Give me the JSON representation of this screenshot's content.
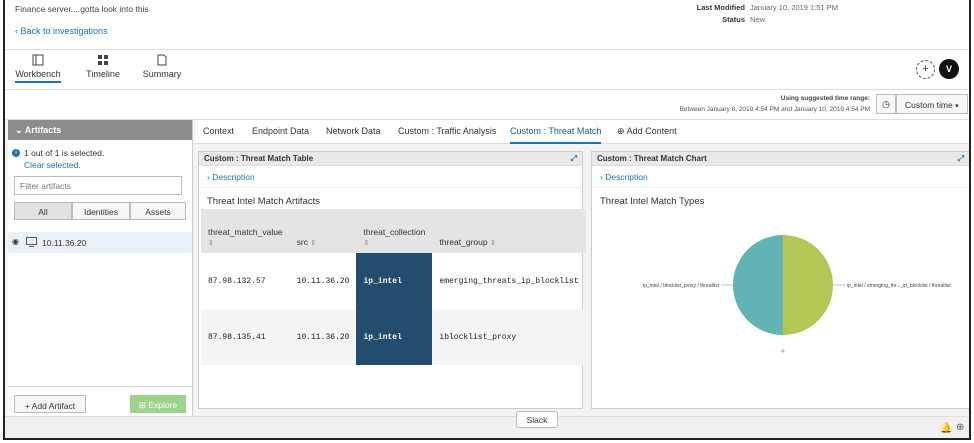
{
  "header": {
    "title": "Finance server....gotta look into this",
    "back_link": "Back to investigations",
    "last_modified_label": "Last Modified",
    "last_modified_value": "January 10, 2019 1:51 PM",
    "status_label": "Status",
    "status_value": "New"
  },
  "nav": {
    "tabs": [
      {
        "label": "Workbench",
        "icon": "workbench-icon"
      },
      {
        "label": "Timeline",
        "icon": "timeline-icon"
      },
      {
        "label": "Summary",
        "icon": "summary-icon"
      }
    ],
    "add_button": "+",
    "avatar": "V"
  },
  "time": {
    "label": "Using suggested time range:",
    "range": "Between January 8, 2019 4:54 PM and January 10, 2019 4:54 PM",
    "button": "Custom time"
  },
  "sidebar": {
    "heading": "Artifacts",
    "selection_text": "1 out of 1 is selected.",
    "clear_link": "Clear selected.",
    "filter_placeholder": "Filter artifacts",
    "segments": [
      "All",
      "Identities",
      "Assets"
    ],
    "artifact": "10.11.36.20",
    "add_button": "+ Add Artifact",
    "explore_button": "Explore"
  },
  "content_tabs": [
    "Context",
    "Endpoint Data",
    "Network Data",
    "Custom : Traffic Analysis",
    "Custom : Threat Match",
    "Add Content"
  ],
  "table_panel": {
    "title": "Custom : Threat Match Table",
    "description": "Description",
    "subtitle": "Threat Intel Match Artifacts",
    "columns": [
      "threat_match_value",
      "src",
      "threat_collection",
      "threat_group"
    ],
    "rows": [
      [
        "87.98.132.57",
        "10.11.36.20",
        "ip_intel",
        "emerging_threats_ip_blocklist"
      ],
      [
        "87.98.135.41",
        "10.11.36.20",
        "ip_intel",
        "iblocklist_proxy"
      ]
    ]
  },
  "chart_panel": {
    "title": "Custom : Threat Match Chart",
    "description": "Description",
    "subtitle": "Threat Intel Match Types"
  },
  "chart_data": {
    "type": "pie",
    "title": "Threat Intel Match Types",
    "slices": [
      {
        "label": "ip_intel / emerging_thr..._ip_blocklist / threatlist",
        "value": 1,
        "color": "#b5c655"
      },
      {
        "label": "ip_intel / blocklist_proxy / threatlist",
        "value": 1,
        "color": "#62b3b3"
      }
    ]
  },
  "footer": {
    "slack": "Slack"
  },
  "colors": {
    "accent": "#1a73b8",
    "highlight": "#244c6f",
    "explore_button": "#9ed38d"
  }
}
